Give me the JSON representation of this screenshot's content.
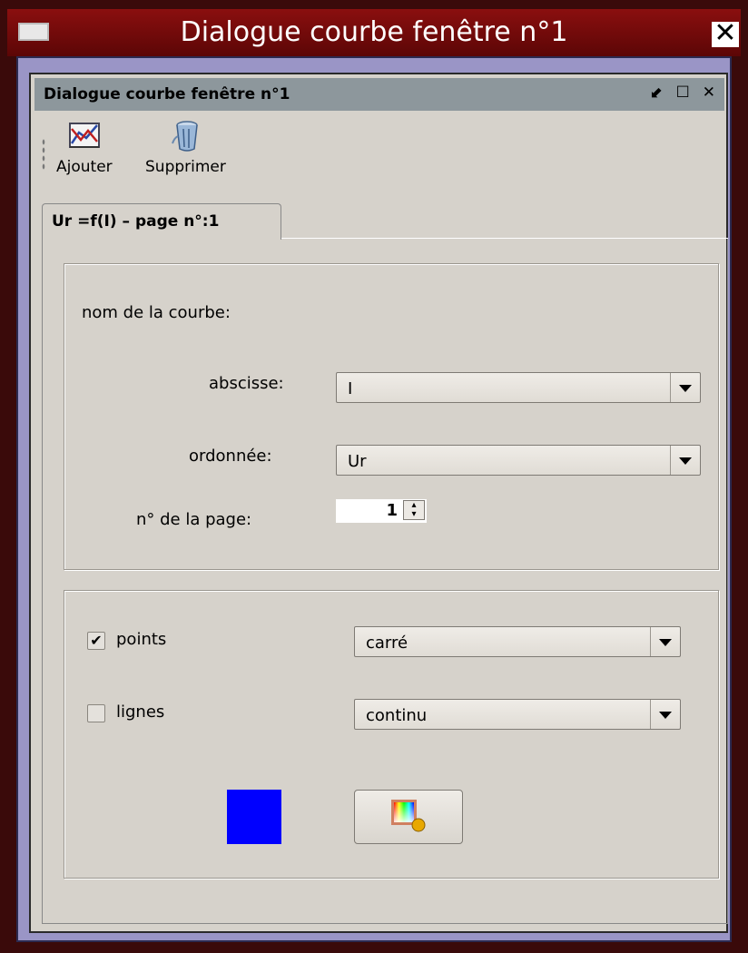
{
  "window": {
    "title": "Dialogue courbe fenêtre n°1",
    "close_glyph": "✕"
  },
  "dock": {
    "title": "Dialogue courbe fenêtre n°1",
    "controls": "⬋ ☐ ✕"
  },
  "toolbar": {
    "add_label": "Ajouter",
    "add_icon": "chart-add-icon",
    "remove_label": "Supprimer",
    "remove_icon": "trash-can-icon"
  },
  "tab": {
    "label": "Ur =f(I) – page n°:1"
  },
  "curve_group": {
    "name_label": "nom de la courbe:",
    "abscissa_label": "abscisse:",
    "abscissa_value": "I",
    "ordinate_label": "ordonnée:",
    "ordinate_value": "Ur",
    "page_label": "n° de la page:",
    "page_value": "1"
  },
  "style_group": {
    "points_label": "points",
    "points_checked": true,
    "points_style": "carré",
    "lines_label": "lignes",
    "lines_checked": false,
    "lines_style": "continu",
    "swatch_color": "#0000ff",
    "color_button_icon": "color-palette-icon"
  }
}
